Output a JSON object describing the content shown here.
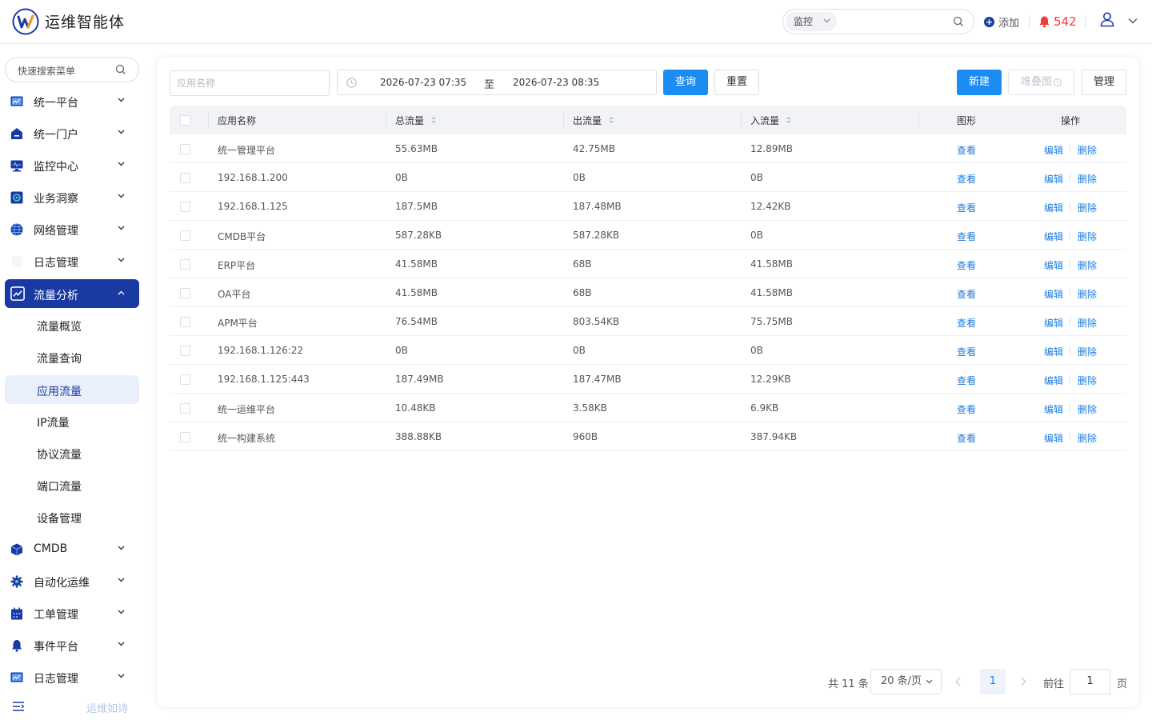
{
  "header": {
    "title": "运维智能体",
    "search_scope": "监控",
    "add_label": "添加",
    "alert_count": "542"
  },
  "sidebar": {
    "search_placeholder": "快速搜索菜单",
    "items": [
      {
        "label": "统一平台",
        "icon": "dashboard-icon"
      },
      {
        "label": "统一门户",
        "icon": "home-icon"
      },
      {
        "label": "监控中心",
        "icon": "monitor-icon"
      },
      {
        "label": "业务洞察",
        "icon": "insight-icon"
      },
      {
        "label": "网络管理",
        "icon": "globe-icon"
      },
      {
        "label": "日志管理",
        "icon": "log-icon"
      },
      {
        "label": "流量分析",
        "icon": "traffic-icon",
        "active": true
      }
    ],
    "sub_items": [
      {
        "label": "流量概览"
      },
      {
        "label": "流量查询"
      },
      {
        "label": "应用流量",
        "active": true
      },
      {
        "label": "IP流量"
      },
      {
        "label": "协议流量"
      },
      {
        "label": "端口流量"
      },
      {
        "label": "设备管理"
      }
    ],
    "lower_items": [
      {
        "label": "CMDB",
        "icon": "cube-icon"
      },
      {
        "label": "自动化运维",
        "icon": "gear-icon"
      },
      {
        "label": "工单管理",
        "icon": "calendar-icon"
      },
      {
        "label": "事件平台",
        "icon": "bell-icon"
      },
      {
        "label": "日志管理",
        "icon": "log-icon"
      }
    ],
    "footer_text": "运维如诗"
  },
  "toolbar": {
    "app_name_placeholder": "应用名称",
    "date_start": "2026-07-23 07:35",
    "date_sep": "至",
    "date_end": "2026-07-23 08:35",
    "query_label": "查询",
    "reset_label": "重置",
    "new_label": "新建",
    "stack_label": "堆叠图",
    "manage_label": "管理"
  },
  "table": {
    "columns": [
      "应用名称",
      "总流量",
      "出流量",
      "入流量",
      "图形",
      "操作"
    ],
    "view_label": "查看",
    "edit_label": "编辑",
    "delete_label": "删除",
    "rows": [
      {
        "name": "统一管理平台",
        "total": "55.63MB",
        "out": "42.75MB",
        "in": "12.89MB"
      },
      {
        "name": "192.168.1.200",
        "total": "0B",
        "out": "0B",
        "in": "0B"
      },
      {
        "name": "192.168.1.125",
        "total": "187.5MB",
        "out": "187.48MB",
        "in": "12.42KB"
      },
      {
        "name": "CMDB平台",
        "total": "587.28KB",
        "out": "587.28KB",
        "in": "0B"
      },
      {
        "name": "ERP平台",
        "total": "41.58MB",
        "out": "68B",
        "in": "41.58MB"
      },
      {
        "name": "OA平台",
        "total": "41.58MB",
        "out": "68B",
        "in": "41.58MB"
      },
      {
        "name": "APM平台",
        "total": "76.54MB",
        "out": "803.54KB",
        "in": "75.75MB"
      },
      {
        "name": "192.168.1.126:22",
        "total": "0B",
        "out": "0B",
        "in": "0B"
      },
      {
        "name": "192.168.1.125:443",
        "total": "187.49MB",
        "out": "187.47MB",
        "in": "12.29KB"
      },
      {
        "name": "统一运维平台",
        "total": "10.48KB",
        "out": "3.58KB",
        "in": "6.9KB"
      },
      {
        "name": "统一构建系统",
        "total": "388.88KB",
        "out": "960B",
        "in": "387.94KB"
      }
    ]
  },
  "pagination": {
    "total_text": "共 11 条",
    "page_size": "20 条/页",
    "current_page": "1",
    "goto_label": "前往",
    "goto_value": "1",
    "page_suffix": "页"
  },
  "colors": {
    "brand": "#1a3aa3",
    "primary": "#1b8cf2",
    "link": "#1b7ee0",
    "alert": "#f03c3c"
  }
}
